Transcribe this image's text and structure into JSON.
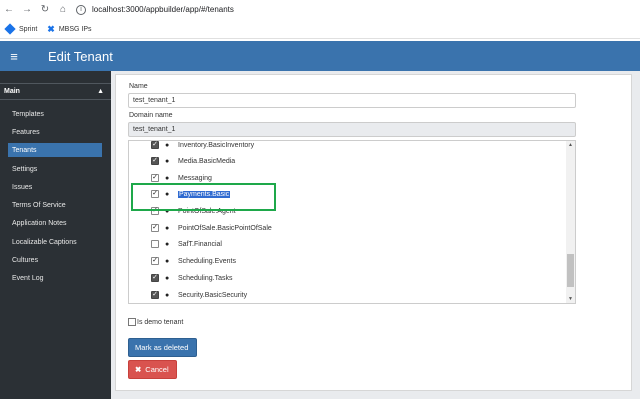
{
  "browser": {
    "url": "localhost:3000/appbuilder/app/#/tenants",
    "bookmarks": [
      "Sprint",
      "MBSG IPs"
    ]
  },
  "app": {
    "title": "Edit Tenant"
  },
  "sidebar": {
    "section": "Main",
    "items": [
      {
        "label": "Templates"
      },
      {
        "label": "Features"
      },
      {
        "label": "Tenants",
        "active": true
      },
      {
        "label": "Settings"
      },
      {
        "label": "Issues"
      },
      {
        "label": "Terms Of Service"
      },
      {
        "label": "Application Notes"
      },
      {
        "label": "Localizable Captions"
      },
      {
        "label": "Cultures"
      },
      {
        "label": "Event Log"
      }
    ]
  },
  "form": {
    "name_label": "Name",
    "name_value": "test_tenant_1",
    "domain_label": "Domain name",
    "domain_value": "test_tenant_1",
    "features": [
      {
        "label": "Inventory.BasicInventory",
        "checked": true,
        "style": "dark"
      },
      {
        "label": "Media.BasicMedia",
        "checked": true,
        "style": "dark"
      },
      {
        "label": "Messaging",
        "checked": true,
        "style": "light"
      },
      {
        "label": "Payments.Basic",
        "checked": true,
        "style": "light",
        "selected": true
      },
      {
        "label": "PointOfSale.Agent",
        "checked": true,
        "style": "light"
      },
      {
        "label": "PointOfSale.BasicPointOfSale",
        "checked": true,
        "style": "light"
      },
      {
        "label": "SafT.Financial",
        "checked": false,
        "style": "light"
      },
      {
        "label": "Scheduling.Events",
        "checked": true,
        "style": "light"
      },
      {
        "label": "Scheduling.Tasks",
        "checked": true,
        "style": "dark"
      },
      {
        "label": "Security.BasicSecurity",
        "checked": true,
        "style": "dark"
      }
    ],
    "demo_label": "Is demo tenant",
    "mark_deleted_label": "Mark as deleted",
    "cancel_label": "Cancel"
  },
  "colors": {
    "header": "#3a73ad",
    "sidebar": "#2b3035",
    "highlight": "#1ea84a",
    "cancel": "#d9534f"
  }
}
